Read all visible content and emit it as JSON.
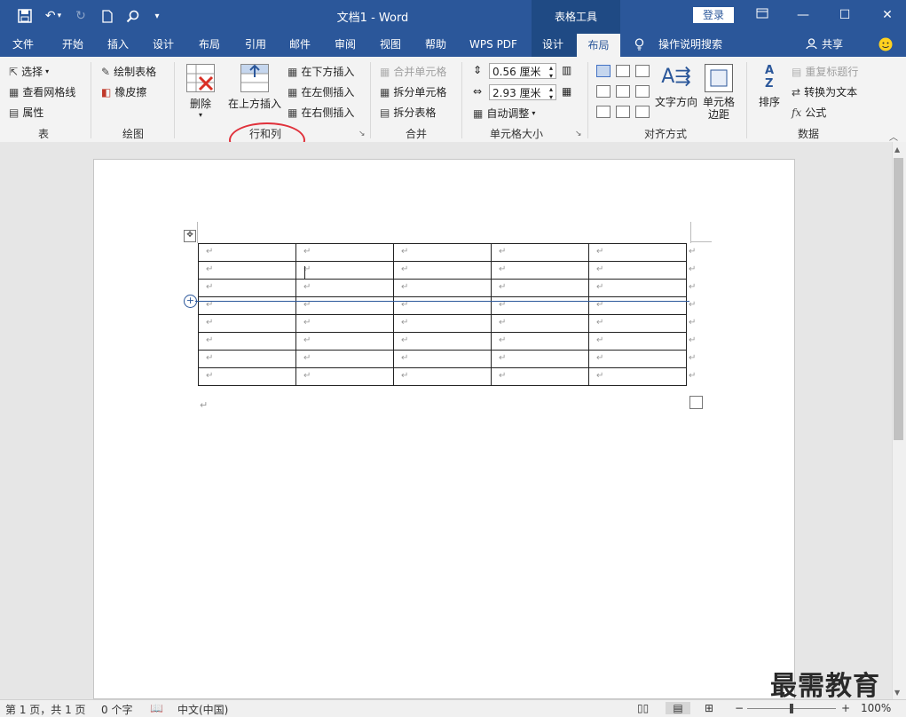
{
  "titlebar": {
    "doc_title": "文档1 - Word",
    "table_tools": "表格工具",
    "login": "登录",
    "qa_icons": [
      "save-icon",
      "undo-icon",
      "redo-icon",
      "new-doc-icon",
      "search-icon",
      "customize-icon"
    ]
  },
  "tabs": [
    "文件",
    "开始",
    "插入",
    "设计",
    "布局",
    "引用",
    "邮件",
    "审阅",
    "视图",
    "帮助",
    "WPS PDF",
    "设计",
    "布局"
  ],
  "tell_me": "操作说明搜索",
  "share": "共享",
  "ribbon": {
    "table_group": {
      "select": "选择",
      "view_gridlines": "查看网格线",
      "properties": "属性",
      "label": "表"
    },
    "draw_group": {
      "draw_table": "绘制表格",
      "eraser": "橡皮擦",
      "label": "绘图"
    },
    "rows_cols_group": {
      "delete": "删除",
      "insert_above": "在上方插入",
      "insert_below": "在下方插入",
      "insert_left": "在左侧插入",
      "insert_right": "在右侧插入",
      "label": "行和列"
    },
    "merge_group": {
      "merge_cells": "合并单元格",
      "split_cells": "拆分单元格",
      "split_table": "拆分表格",
      "label": "合并"
    },
    "cell_size_group": {
      "height": "0.56 厘米",
      "width": "2.93 厘米",
      "autofit": "自动调整",
      "label": "单元格大小"
    },
    "alignment_group": {
      "text_direction": "文字方向",
      "cell_margins_1": "单元格",
      "cell_margins_2": "边距",
      "label": "对齐方式"
    },
    "data_group": {
      "sort": "排序",
      "repeat_header": "重复标题行",
      "convert_to_text": "转换为文本",
      "formula": "公式",
      "label": "数据"
    }
  },
  "table": {
    "rows": 8,
    "cols": 5,
    "cell_mark": "↵"
  },
  "statusbar": {
    "page": "第 1 页，共 1 页",
    "words": "0 个字",
    "language": "中文(中国)",
    "zoom": "100%"
  },
  "watermark": "最需教育",
  "colors": {
    "title_blue": "#2b579a",
    "context_blue": "#1f4a84",
    "annotation_red": "#e0313b"
  }
}
